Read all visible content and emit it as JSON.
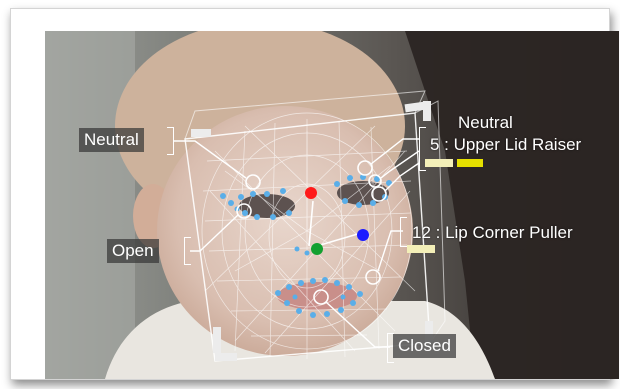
{
  "annotations": {
    "left_eye_label": "Neutral",
    "mouth_label": "Open",
    "right_eye_label": "Neutral",
    "au5_label": "5 : Upper Lid Raiser",
    "au12_label": "12 : Lip Corner Puller",
    "lips_label": "Closed"
  },
  "intensity_bars": {
    "au5": {
      "bar1_color": "#f3efb8",
      "bar2_color": "#e6e000"
    },
    "au12": {
      "bar1_color": "#f3efb8"
    }
  },
  "landmark_colors": {
    "red": "#ff1a1a",
    "blue": "#1c1cff",
    "green": "#12a030",
    "points": "#5aaee8"
  }
}
